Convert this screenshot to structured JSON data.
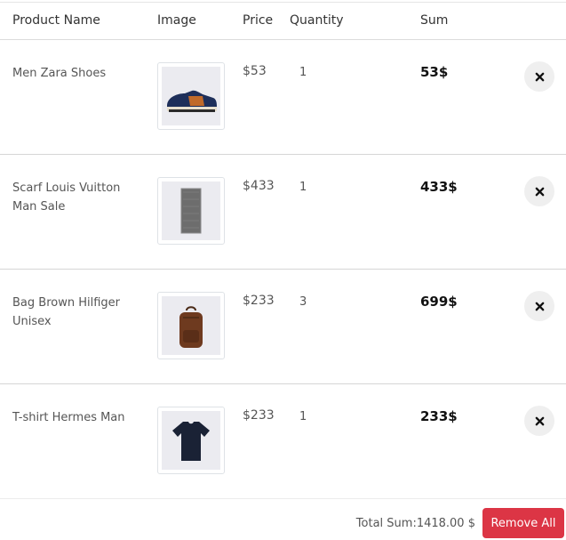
{
  "table": {
    "headers": {
      "product": "Product Name",
      "image": "Image",
      "price": "Price",
      "quantity": "Quantity",
      "sum": "Sum"
    },
    "rows": [
      {
        "name": "Men Zara Shoes",
        "image_icon": "sneaker-icon",
        "price": "$53",
        "quantity": "1",
        "sum": "53$"
      },
      {
        "name": "Scarf Louis Vuitton Man Sale",
        "image_icon": "scarf-icon",
        "price": "$433",
        "quantity": "1",
        "sum": "433$"
      },
      {
        "name": "Bag Brown Hilfiger Unisex",
        "image_icon": "backpack-icon",
        "price": "$233",
        "quantity": "3",
        "sum": "699$"
      },
      {
        "name": "T-shirt Hermes Man",
        "image_icon": "tshirt-icon",
        "price": "$233",
        "quantity": "1",
        "sum": "233$"
      }
    ]
  },
  "footer": {
    "total_text": "Total Sum:1418.00 $",
    "remove_all_label": "Remove All"
  },
  "colors": {
    "danger": "#dc3545",
    "remove_circle": "#efefef"
  }
}
